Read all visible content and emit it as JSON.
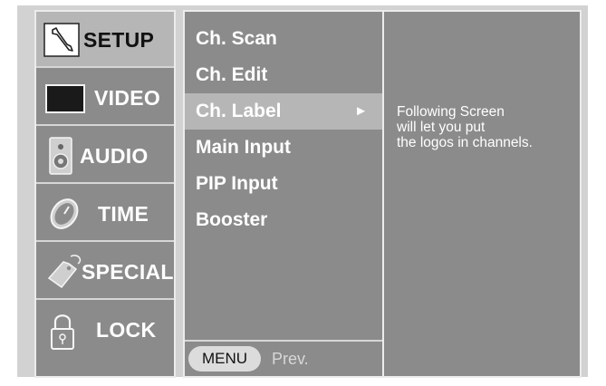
{
  "categories": [
    {
      "label": "SETUP",
      "icon": "wrench-icon",
      "active": true
    },
    {
      "label": "VIDEO",
      "icon": "monitor-icon",
      "active": false
    },
    {
      "label": "AUDIO",
      "icon": "speaker-icon",
      "active": false
    },
    {
      "label": "TIME",
      "icon": "clock-icon",
      "active": false
    },
    {
      "label": "SPECIAL",
      "icon": "tag-icon",
      "active": false
    },
    {
      "label": "LOCK",
      "icon": "padlock-icon",
      "active": false
    }
  ],
  "menu": {
    "items": [
      {
        "label": "Ch. Scan",
        "selected": false
      },
      {
        "label": "Ch. Edit",
        "selected": false
      },
      {
        "label": "Ch. Label",
        "selected": true,
        "arrow": "►"
      },
      {
        "label": "Main Input",
        "selected": false
      },
      {
        "label": "PIP Input",
        "selected": false
      },
      {
        "label": "Booster",
        "selected": false
      }
    ],
    "footer": {
      "menu_button": "MENU",
      "prev_label": "Prev."
    }
  },
  "info": {
    "lines": [
      "Following Screen",
      "will let you put",
      "the logos in channels."
    ]
  },
  "colors": {
    "panel": "#8b8b8b",
    "highlight": "#b6b6b6",
    "frame": "#d2d2d2",
    "text": "#ffffff"
  }
}
